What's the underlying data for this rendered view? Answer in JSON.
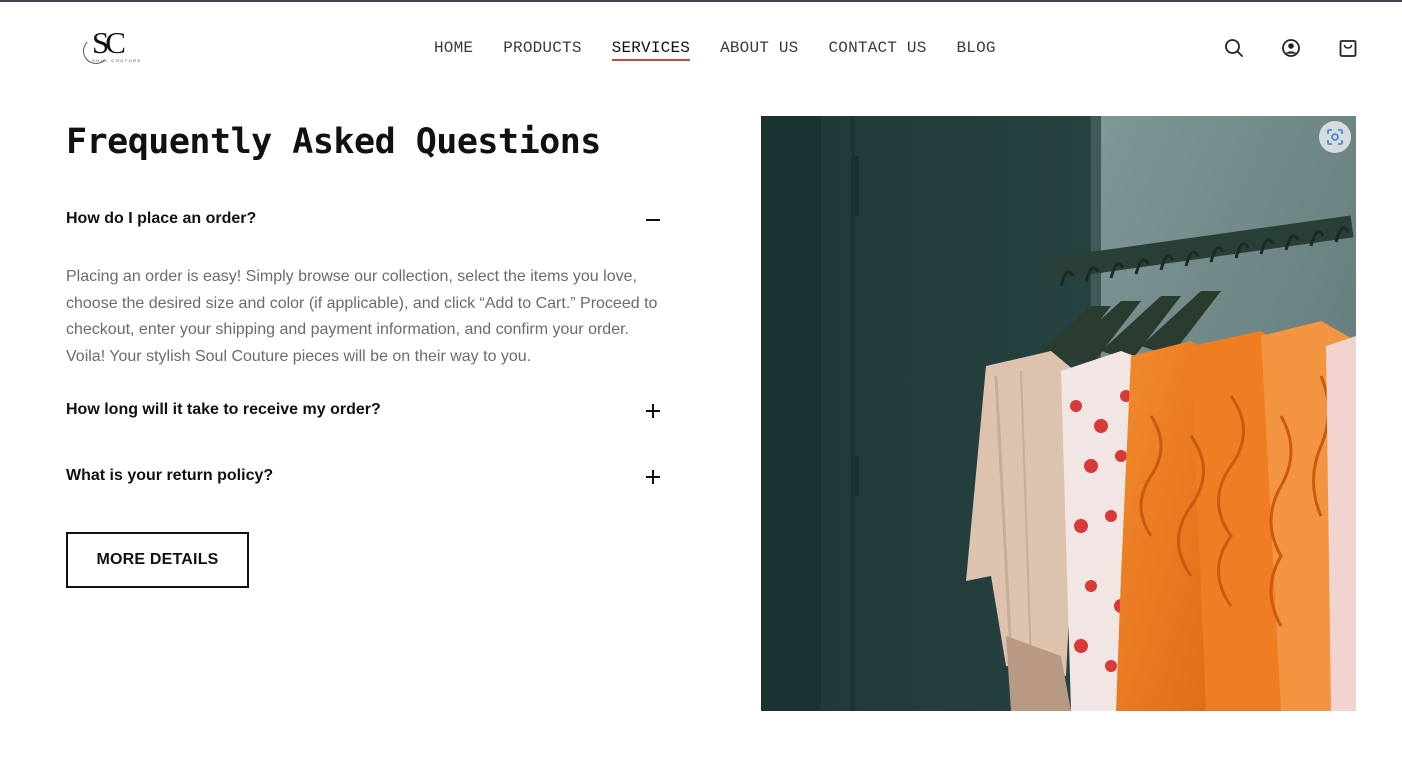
{
  "header": {
    "logo": {
      "mark": "SC",
      "subtext": "SOUL COUTURE"
    },
    "nav": [
      {
        "label": "HOME"
      },
      {
        "label": "PRODUCTS"
      },
      {
        "label": "SERVICES",
        "active": true
      },
      {
        "label": "ABOUT US"
      },
      {
        "label": "CONTACT US"
      },
      {
        "label": "BLOG"
      }
    ],
    "icons": [
      "search-icon",
      "account-icon",
      "cart-icon"
    ]
  },
  "faq": {
    "title": "Frequently Asked Questions",
    "items": [
      {
        "question": "How do I place an order?",
        "expanded": true,
        "answer": "Placing an order is easy! Simply browse our collection, select the items you love, choose the desired size and color (if applicable), and click “Add to Cart.” Proceed to checkout, enter your shipping and payment information, and confirm your order. Voila! Your stylish Soul Couture pieces will be on their way to you."
      },
      {
        "question": "How long will it take to receive my order?",
        "expanded": false
      },
      {
        "question": "What is your return policy?",
        "expanded": false
      }
    ],
    "button_label": "MORE DETAILS"
  },
  "photo": {
    "icon": "visual-search-icon"
  },
  "colors": {
    "accent_underline": "#e0403e",
    "text": "#111111",
    "muted_text": "#6b6b6b"
  }
}
